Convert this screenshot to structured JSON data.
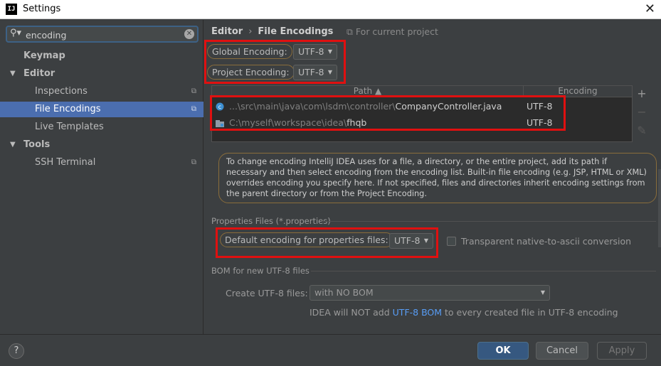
{
  "window": {
    "title": "Settings",
    "logo_text": "IJ",
    "close_glyph": "✕"
  },
  "search": {
    "value": "encoding",
    "icon": "search-icon",
    "clear_glyph": "✕",
    "icon_glyph": "⚲▾"
  },
  "sidebar": {
    "items": [
      {
        "label": "Keymap",
        "bold": true
      },
      {
        "label": "Editor",
        "bold": true,
        "expanded": true
      },
      {
        "label": "Inspections"
      },
      {
        "label": "File Encodings",
        "selected": true
      },
      {
        "label": "Live Templates"
      },
      {
        "label": "Tools",
        "bold": true,
        "expanded": true
      },
      {
        "label": "SSH Terminal"
      }
    ],
    "arrow_glyph": "▼",
    "copy_glyph": "⧉"
  },
  "breadcrumb": {
    "parent": "Editor",
    "sep": "›",
    "current": "File Encodings",
    "scope_hint": "For current project",
    "scope_glyph": "⧉"
  },
  "encodings": {
    "global_label": "Global Encoding:",
    "global_value": "UTF-8",
    "project_label": "Project Encoding:",
    "project_value": "UTF-8",
    "caret": "▼"
  },
  "table": {
    "headers": {
      "path": "Path ▲",
      "encoding": "Encoding"
    },
    "rows": [
      {
        "path_dim": "...\\src\\main\\java\\com\\lsdm\\controller\\",
        "path_bright": "CompanyController.java",
        "encoding": "UTF-8",
        "icon": "java-class-icon"
      },
      {
        "path_dim": "C:\\myself\\workspace\\idea\\",
        "path_bright": "fhqb",
        "encoding": "UTF-8",
        "icon": "folder-icon"
      }
    ],
    "actions": {
      "add": "+",
      "remove": "−",
      "edit": "✎"
    }
  },
  "info_text": "To change encoding IntelliJ IDEA uses for a file, a directory, or the entire project, add its path if necessary and then select encoding from the encoding list. Built-in file encoding (e.g. JSP, HTML or XML) overrides encoding you specify here. If not specified, files and directories inherit encoding settings from the parent directory or from the Project Encoding.",
  "properties": {
    "section": "Properties Files (*.properties)",
    "default_label": "Default encoding for properties files:",
    "default_value": "UTF-8",
    "transparent_label": "Transparent native-to-ascii conversion",
    "transparent_checked": false
  },
  "bom": {
    "section": "BOM for new UTF-8 files",
    "create_label": "Create UTF-8 files:",
    "create_value": "with NO BOM",
    "note_prefix": "IDEA will NOT add ",
    "note_link": "UTF-8 BOM",
    "note_suffix": " to every created file in UTF-8 encoding"
  },
  "footer": {
    "help": "?",
    "ok": "OK",
    "cancel": "Cancel",
    "apply": "Apply"
  },
  "colors": {
    "highlight": "#e01010",
    "accent": "#4b6eaf",
    "link": "#589df6"
  }
}
